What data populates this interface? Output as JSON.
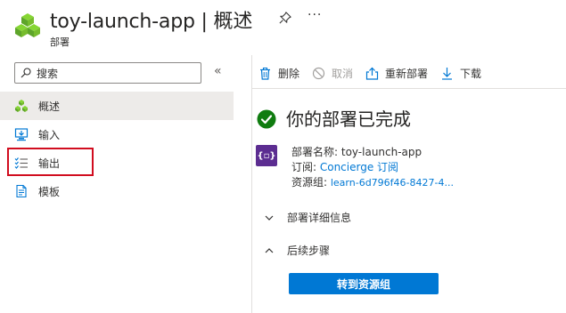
{
  "header": {
    "title": "toy-launch-app | 概述",
    "subtitle": "部署",
    "more_label": "···"
  },
  "search": {
    "placeholder": "搜索",
    "collapse_label": "«"
  },
  "sidebar": {
    "items": [
      {
        "label": "概述",
        "icon": "overview-icon",
        "active": true
      },
      {
        "label": "输入",
        "icon": "inputs-icon",
        "active": false
      },
      {
        "label": "输出",
        "icon": "outputs-icon",
        "active": false
      },
      {
        "label": "模板",
        "icon": "template-icon",
        "active": false
      }
    ]
  },
  "toolbar": {
    "delete_label": "删除",
    "cancel_label": "取消",
    "redeploy_label": "重新部署",
    "download_label": "下载"
  },
  "main": {
    "status_title": "你的部署已完成",
    "deployment_name_label": "部署名称: ",
    "deployment_name_value": "toy-launch-app",
    "subscription_label": "订阅: ",
    "subscription_value": "Concierge 订阅",
    "resource_group_label": "资源组: ",
    "resource_group_value": "learn-6d796f46-8427-4...",
    "deployment_details_label": "部署详细信息",
    "next_steps_label": "后续步骤",
    "go_to_rg_button": "转到资源组"
  },
  "colors": {
    "accent": "#0078d4",
    "success": "#107c10",
    "highlight": "#d10d1f",
    "deploy_icon_bg": "#5c2d91"
  }
}
